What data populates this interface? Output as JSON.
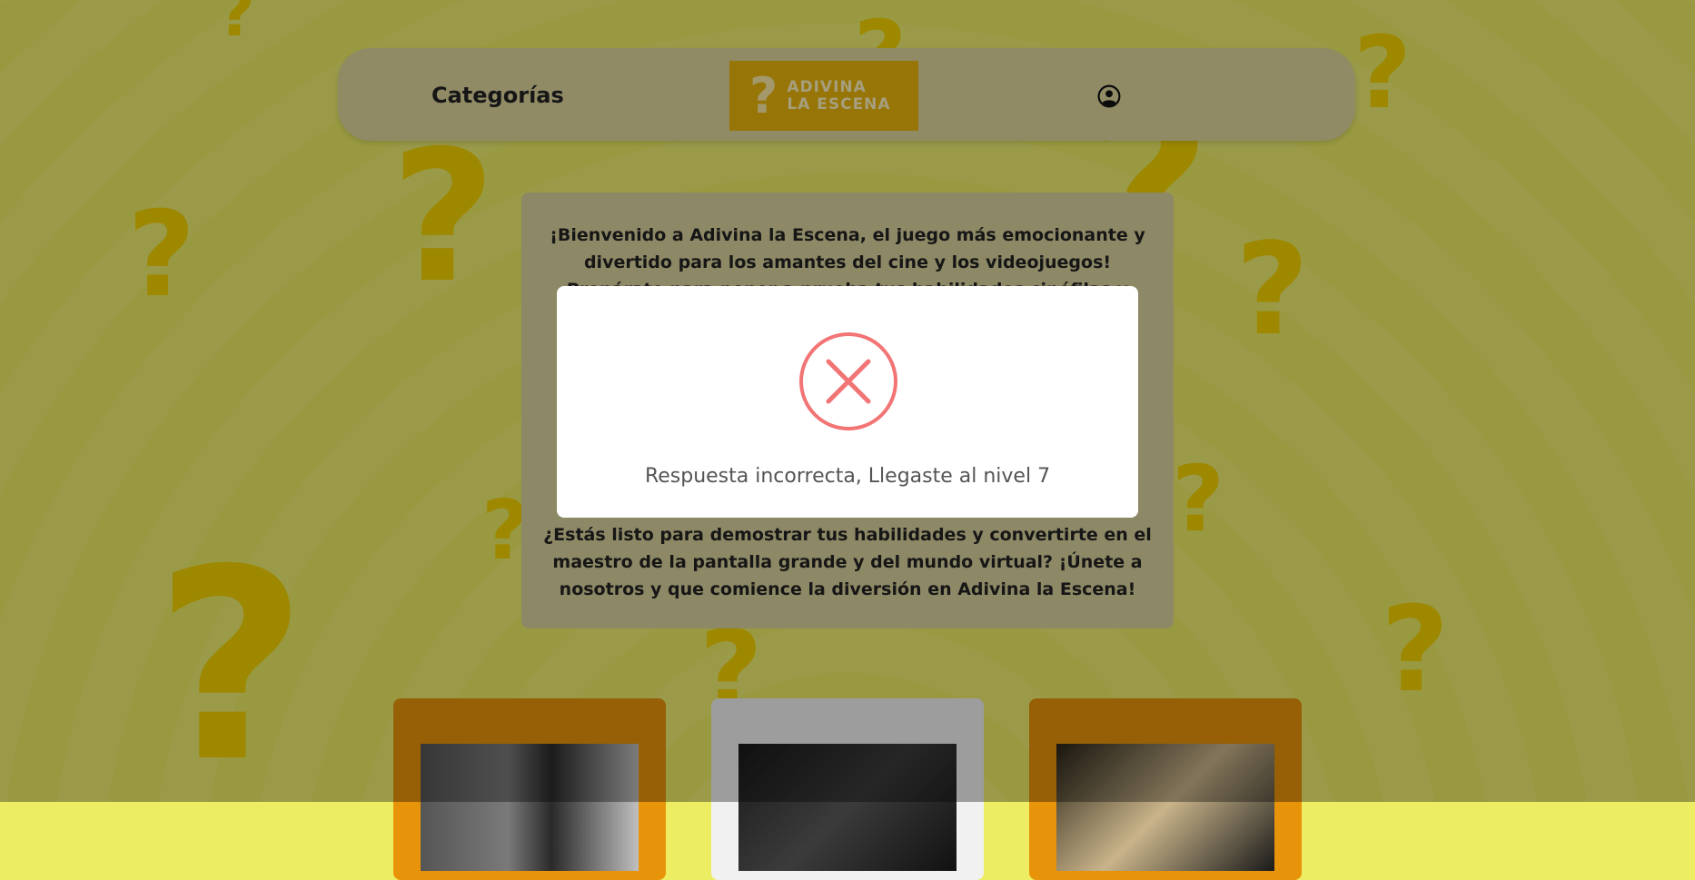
{
  "header": {
    "nav_categories": "Categorías",
    "logo_line1": "Adivina",
    "logo_line2": "la escena",
    "user_icon": "user-circle-icon"
  },
  "intro": {
    "paragraph1": "¡Bienvenido a Adivina la Escena, el juego más emocionante y divertido para los amantes del cine y los videojuegos! Prepárate para poner a prueba tus habilidades cinéfilas y demostrar tu conocimiento infinito sobre las escenas más icónicas del cine y los videojuegos.",
    "paragraph2": "¿Estás listo para demostrar tus habilidades y convertirte en el maestro de la pantalla grande y del mundo virtual? ¡Únete a nosotros y que comience la diversión en Adivina la Escena!"
  },
  "cards": [
    {
      "bg": "#e8940a"
    },
    {
      "bg": "#f1f1f1"
    },
    {
      "bg": "#e8940a"
    }
  ],
  "modal": {
    "icon": "error-x-icon",
    "message": "Respuesta incorrecta, Llegaste al nivel 7"
  },
  "colors": {
    "background": "#ecec66",
    "question_marks": "#f2d200",
    "header_bg": "#ddd49c",
    "logo_bg": "#e8b40c",
    "error": "#f27474"
  }
}
